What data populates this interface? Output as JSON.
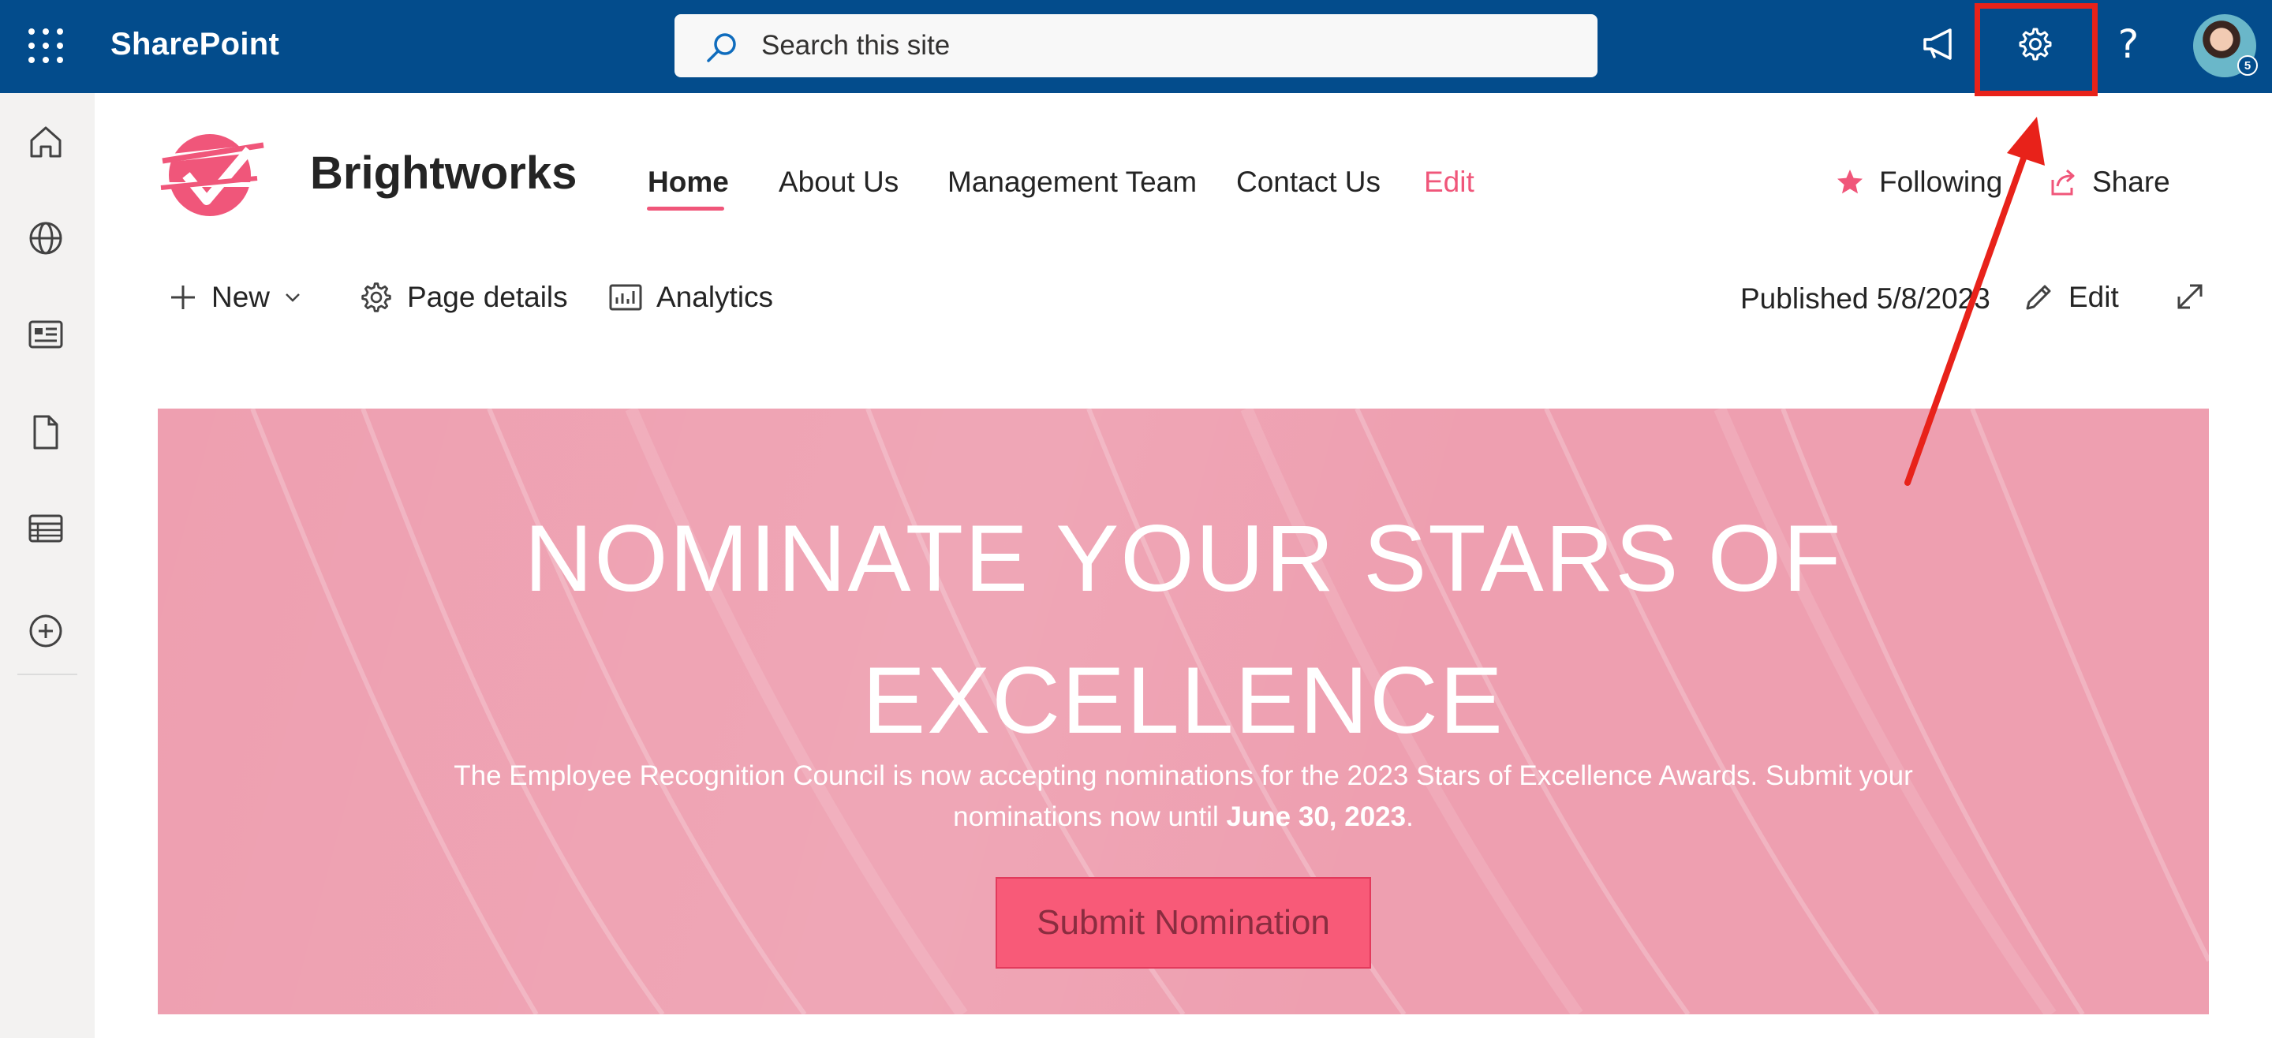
{
  "suite_bar": {
    "app_name": "SharePoint",
    "search_placeholder": "Search this site",
    "help_glyph": "?",
    "avatar_badge": "5"
  },
  "site_header": {
    "title": "Brightworks",
    "nav": [
      {
        "label": "Home",
        "active": true
      },
      {
        "label": "About Us"
      },
      {
        "label": "Management Team"
      },
      {
        "label": "Contact Us"
      },
      {
        "label": "Edit"
      }
    ],
    "following_label": "Following",
    "share_label": "Share"
  },
  "command_bar": {
    "new_label": "New",
    "page_details_label": "Page details",
    "analytics_label": "Analytics",
    "published_label": "Published 5/8/2023",
    "edit_label": "Edit"
  },
  "hero": {
    "title_line1": "NOMINATE YOUR STARS OF",
    "title_line2": "EXCELLENCE",
    "body_text": "The Employee Recognition Council is now accepting nominations for the 2023 Stars of Excellence Awards. Submit your nominations now until ",
    "body_deadline": "June 30, 2023",
    "body_end": ".",
    "button_label": "Submit Nomination"
  },
  "colors": {
    "suite_bar": "#034c8c",
    "accent": "#f0567a",
    "hero_bg": "#ee9fb0",
    "button_bg": "#f85a78",
    "annotation": "#e8221a"
  },
  "icons": {
    "suite_bar": [
      "waffle-icon",
      "search-icon",
      "megaphone-icon",
      "gear-icon",
      "help-icon"
    ],
    "app_bar": [
      "home-icon",
      "globe-icon",
      "news-icon",
      "document-icon",
      "list-icon",
      "add-icon"
    ]
  }
}
